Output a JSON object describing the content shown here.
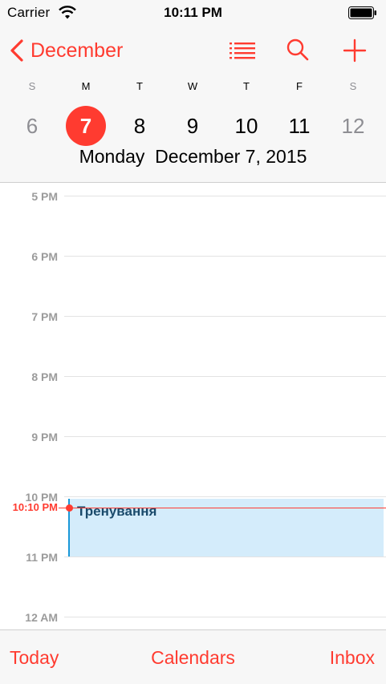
{
  "status_bar": {
    "carrier": "Carrier",
    "time": "10:11 PM"
  },
  "nav": {
    "back_label": "December",
    "icons": [
      "list-icon",
      "search-icon",
      "add-icon"
    ]
  },
  "week": {
    "letters": [
      "S",
      "M",
      "T",
      "W",
      "T",
      "F",
      "S"
    ],
    "days": [
      "6",
      "7",
      "8",
      "9",
      "10",
      "11",
      "12"
    ],
    "selected_index": 1,
    "selected_date": "Monday  December 7, 2015"
  },
  "timeline": {
    "hours": [
      "5 PM",
      "6 PM",
      "7 PM",
      "8 PM",
      "9 PM",
      "10 PM",
      "11 PM",
      "12 AM"
    ],
    "now_label": "10:10 PM",
    "event": {
      "title": "Тренування"
    }
  },
  "tabs": {
    "today": "Today",
    "calendars": "Calendars",
    "inbox": "Inbox"
  },
  "colors": {
    "accent": "#ff3b30",
    "event_fill": "#d4ecfb",
    "event_border": "#1a98d8"
  }
}
